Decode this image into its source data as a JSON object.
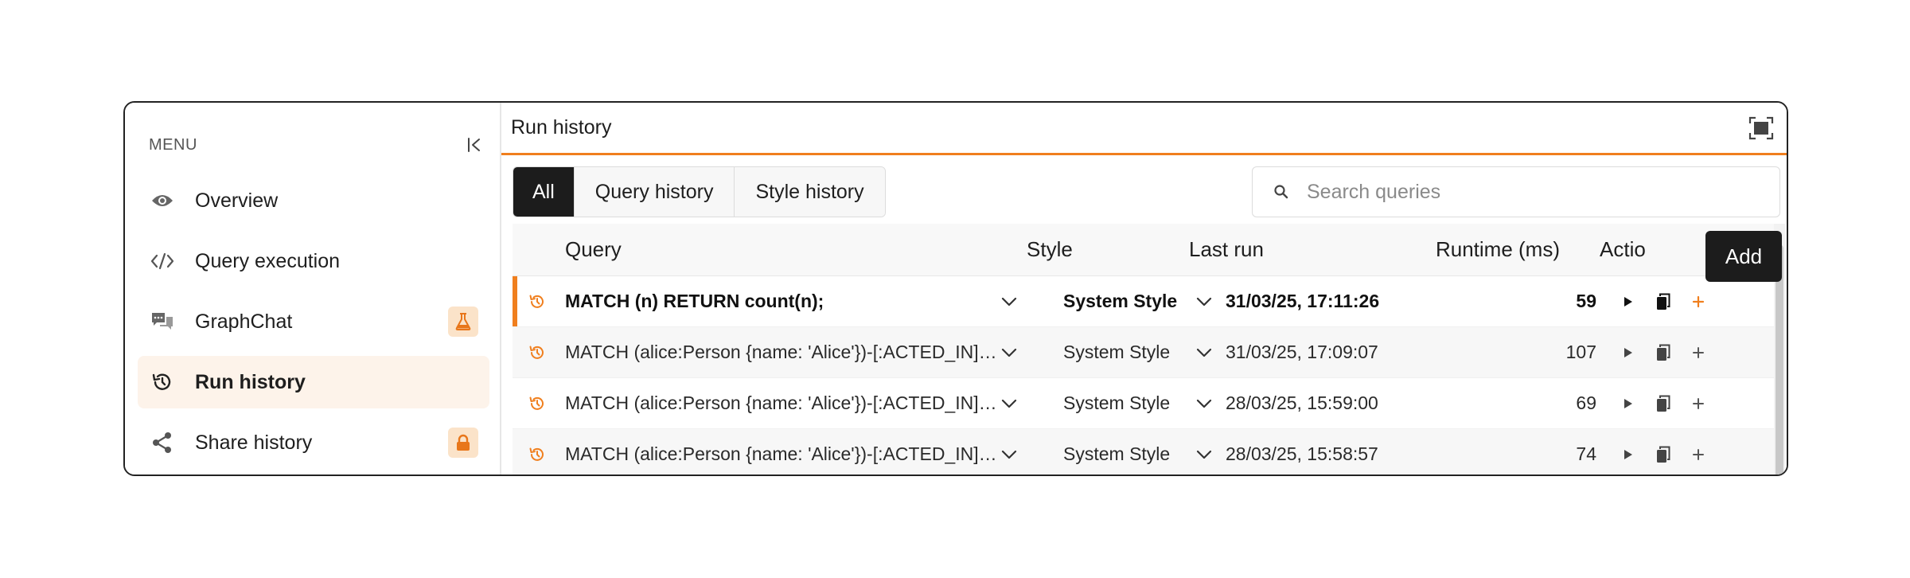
{
  "sidebar": {
    "menu_title": "MENU",
    "items": [
      {
        "label": "Overview",
        "icon": "eye-icon"
      },
      {
        "label": "Query execution",
        "icon": "code-icon"
      },
      {
        "label": "GraphChat",
        "icon": "chat-icon",
        "badge": "flask-icon"
      },
      {
        "label": "Run history",
        "icon": "history-icon",
        "active": true
      },
      {
        "label": "Share history",
        "icon": "share-icon",
        "badge": "lock-icon"
      }
    ]
  },
  "main": {
    "title": "Run history",
    "tabs": [
      "All",
      "Query history",
      "Style history"
    ],
    "active_tab": "All",
    "search": {
      "placeholder": "Search queries",
      "value": ""
    },
    "columns": {
      "query": "Query",
      "style": "Style",
      "last_run": "Last run",
      "runtime": "Runtime (ms)",
      "actions": "Actio"
    },
    "rows": [
      {
        "query": "MATCH (n) RETURN count(n);",
        "style": "System Style",
        "last_run": "31/03/25, 17:11:26",
        "runtime": "59",
        "selected": true
      },
      {
        "query": "MATCH (alice:Person {name: 'Alice'})-[:ACTED_IN]→(...",
        "style": "System Style",
        "last_run": "31/03/25, 17:09:07",
        "runtime": "107"
      },
      {
        "query": "MATCH (alice:Person {name: 'Alice'})-[:ACTED_IN]→(...",
        "style": "System Style",
        "last_run": "28/03/25, 15:59:00",
        "runtime": "69"
      },
      {
        "query": "MATCH (alice:Person {name: 'Alice'})-[:ACTED_IN]→(...",
        "style": "System Style",
        "last_run": "28/03/25, 15:58:57",
        "runtime": "74"
      }
    ],
    "tooltip": "Add"
  },
  "colors": {
    "accent": "#f07f1e",
    "active_bg": "#fdf3ea",
    "badge_bg": "#fbe3c9",
    "dark": "#1c1c1c"
  }
}
